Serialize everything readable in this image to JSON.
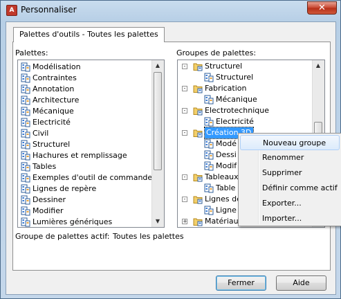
{
  "window": {
    "title": "Personnaliser",
    "close_glyph": "✕"
  },
  "tab": {
    "label": "Palettes d'outils - Toutes les palettes"
  },
  "palettes": {
    "label": "Palettes:",
    "items": [
      "Modélisation",
      "Contraintes",
      "Annotation",
      "Architecture",
      "Mécanique",
      "Electricité",
      "Civil",
      "Structurel",
      "Hachures et remplissage",
      "Tables",
      "Exemples d'outil de commande",
      "Lignes de repère",
      "Dessiner",
      "Modifier",
      "Lumières génériques"
    ]
  },
  "groups": {
    "label": "Groupes de palettes:",
    "tree": [
      {
        "text": "Structurel",
        "level": 0,
        "exp": "-",
        "type": "folder"
      },
      {
        "text": "Structurel",
        "level": 1,
        "type": "palette"
      },
      {
        "text": "Fabrication",
        "level": 0,
        "exp": "-",
        "type": "folder"
      },
      {
        "text": "Mécanique",
        "level": 1,
        "type": "palette"
      },
      {
        "text": "Electrotechnique",
        "level": 0,
        "exp": "-",
        "type": "folder"
      },
      {
        "text": "Electricité",
        "level": 1,
        "type": "palette"
      },
      {
        "text": "Création 3D",
        "level": 0,
        "exp": "-",
        "type": "folder",
        "selected": true
      },
      {
        "text": "Modé",
        "level": 1,
        "type": "palette"
      },
      {
        "text": "Dessi",
        "level": 1,
        "type": "palette"
      },
      {
        "text": "Modif",
        "level": 1,
        "type": "palette"
      },
      {
        "text": "Tableaux",
        "level": 0,
        "exp": "-",
        "type": "folder"
      },
      {
        "text": "Table",
        "level": 1,
        "type": "palette"
      },
      {
        "text": "Lignes de",
        "level": 0,
        "exp": "-",
        "type": "folder"
      },
      {
        "text": "Ligne",
        "level": 1,
        "type": "palette"
      },
      {
        "text": "Matériaux",
        "level": 0,
        "exp": "+",
        "type": "folder"
      }
    ]
  },
  "active_group": {
    "label": "Groupe de palettes actif:",
    "value": "Toutes les palettes"
  },
  "context_menu": [
    "Nouveau groupe",
    "Renommer",
    "Supprimer",
    "Définir comme actif",
    "Exporter...",
    "Importer..."
  ],
  "buttons": {
    "ok": "Fermer",
    "help": "Aide"
  },
  "colors": {
    "selection": "#3399ff",
    "accent": "#3c7fb1"
  }
}
